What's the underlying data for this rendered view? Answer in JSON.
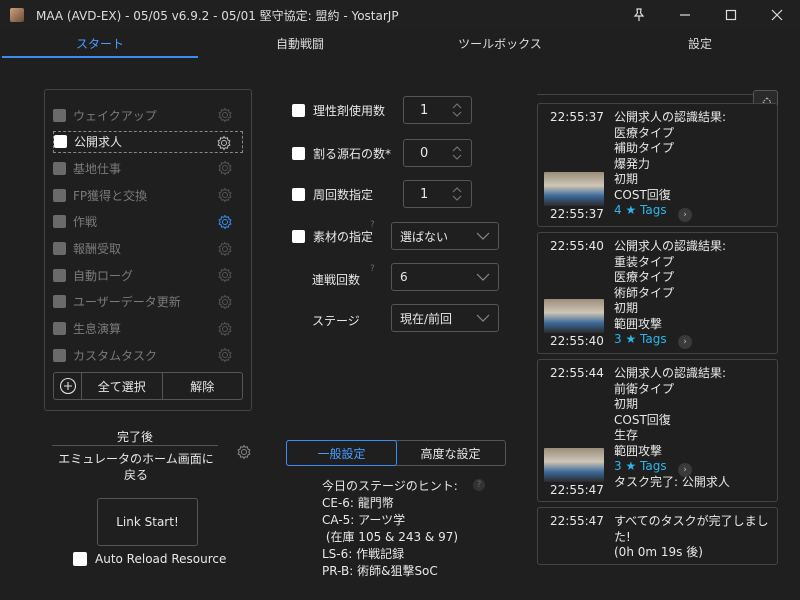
{
  "window": {
    "title": "MAA (AVD-EX) - 05/05 v6.9.2 - 05/01 堅守協定: 盟約 - YostarJP",
    "pin_icon": "pin-icon",
    "minimize_icon": "minimize-icon",
    "maximize_icon": "maximize-icon",
    "close_icon": "close-icon"
  },
  "tabs": [
    {
      "label": "スタート",
      "active": true
    },
    {
      "label": "自動戦闘",
      "active": false
    },
    {
      "label": "ツールボックス",
      "active": false
    },
    {
      "label": "設定",
      "active": false
    }
  ],
  "tasks": [
    {
      "label": "ウェイクアップ",
      "checked": false,
      "enabled": false,
      "gear_highlight": false
    },
    {
      "label": "公開求人",
      "checked": false,
      "enabled": true,
      "selected": true,
      "gear_highlight": false
    },
    {
      "label": "基地仕事",
      "checked": false,
      "enabled": false,
      "gear_highlight": false
    },
    {
      "label": "FP獲得と交換",
      "checked": false,
      "enabled": false,
      "gear_highlight": false
    },
    {
      "label": "作戦",
      "checked": false,
      "enabled": false,
      "gear_highlight": true
    },
    {
      "label": "報酬受取",
      "checked": false,
      "enabled": false,
      "gear_highlight": false
    },
    {
      "label": "自動ローグ",
      "checked": false,
      "enabled": false,
      "gear_highlight": false
    },
    {
      "label": "ユーザーデータ更新",
      "checked": false,
      "enabled": false,
      "gear_highlight": false
    },
    {
      "label": "生息演算",
      "checked": false,
      "enabled": false,
      "gear_highlight": false
    },
    {
      "label": "カスタムタスク",
      "checked": false,
      "enabled": false,
      "gear_highlight": false
    }
  ],
  "task_buttons": {
    "add_icon": "plus-circle-icon",
    "select_all": "全て選択",
    "clear": "解除"
  },
  "after_complete": {
    "label": "完了後",
    "value": "エミュレータのホーム画面に戻る"
  },
  "link_start": "Link Start!",
  "auto_reload": "Auto Reload Resource",
  "settings": {
    "sanity_potion": {
      "label": "理性剤使用数",
      "value": "1"
    },
    "originium": {
      "label": "割る源石の数*",
      "value": "0"
    },
    "times": {
      "label": "周回数指定",
      "value": "1"
    },
    "material": {
      "label": "素材の指定",
      "value": "選ばない"
    },
    "series": {
      "label": "連戦回数",
      "value": "6"
    },
    "stage": {
      "label": "ステージ",
      "value": "現在/前回"
    }
  },
  "segment": {
    "general": "一般設定",
    "advanced": "高度な設定"
  },
  "hints": {
    "title": "今日のステージのヒント:",
    "lines": [
      "CE-6: 龍門幣",
      "CA-5: アーツ学",
      " (在庫 105 & 243 & 97)",
      "LS-6: 作戦記録",
      "PR-B: 術師&狙撃SoC"
    ]
  },
  "log": [
    {
      "time": "22:55:37",
      "lines": [
        "公開求人の認識結果:",
        "医療タイプ",
        "補助タイプ",
        "爆発力",
        "初期",
        "COST回復"
      ],
      "tags": "4 ★ Tags",
      "time2": "22:55:37"
    },
    {
      "time": "22:55:40",
      "lines": [
        "公開求人の認識結果:",
        "重装タイプ",
        "医療タイプ",
        "術師タイプ",
        "初期",
        "範囲攻撃"
      ],
      "tags": "3 ★ Tags",
      "time2": "22:55:40"
    },
    {
      "time": "22:55:44",
      "lines": [
        "公開求人の認識結果:",
        "前衛タイプ",
        "初期",
        "COST回復",
        "生存",
        "範囲攻撃"
      ],
      "tags": "3 ★ Tags",
      "time2": "22:55:47",
      "extra": "タスク完了: 公開求人"
    },
    {
      "time": "22:55:47",
      "lines": [
        "すべてのタスクが完了しまし",
        "た!",
        "(0h 0m 19s 後)"
      ]
    }
  ],
  "colors": {
    "background": "#1f1f1f",
    "accent": "#3b8cf0",
    "tags": "#2ab6e8"
  }
}
